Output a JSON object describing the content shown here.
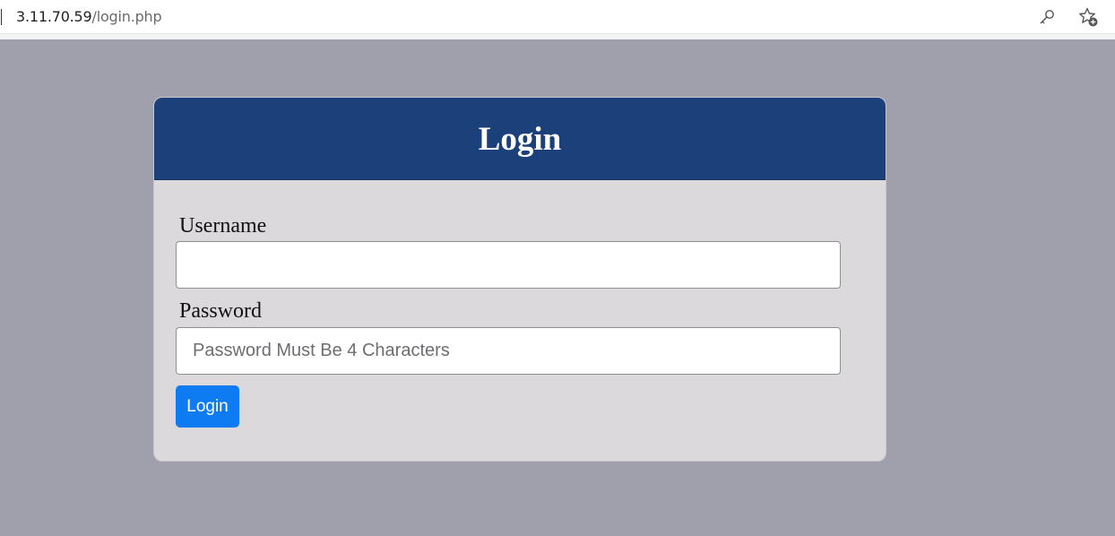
{
  "browser": {
    "url_host": "3.11.70.59",
    "url_path": "/login.php",
    "icons": [
      "key-icon",
      "add-favorite-icon"
    ]
  },
  "login": {
    "title": "Login",
    "username_label": "Username",
    "username_value": "",
    "password_label": "Password",
    "password_placeholder": "Password Must Be 4 Characters",
    "submit_label": "Login"
  },
  "colors": {
    "page_background": "#a09fac",
    "header_background": "#1b407a",
    "card_background": "#dbd9db",
    "button_background": "#0f7bf2"
  }
}
